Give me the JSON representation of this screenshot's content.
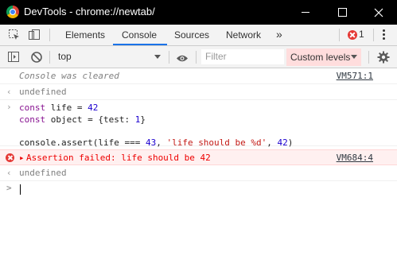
{
  "window": {
    "title": "DevTools - chrome://newtab/"
  },
  "tabs": {
    "items": [
      {
        "label": "Elements"
      },
      {
        "label": "Console"
      },
      {
        "label": "Sources"
      },
      {
        "label": "Network"
      }
    ],
    "more_label": "»",
    "error_count": "1"
  },
  "console_toolbar": {
    "context": "top",
    "filter_placeholder": "Filter",
    "levels_label": "Custom levels"
  },
  "messages": {
    "cleared": {
      "text": "Console was cleared",
      "source": "VM571:1"
    },
    "result1": {
      "text": "undefined"
    },
    "input1": {
      "line1_kw": "const",
      "line1_rest": " life = ",
      "line1_num": "42",
      "line2_kw": "const",
      "line2_rest": " object = {test: ",
      "line2_num": "1",
      "line2_end": "}",
      "line4_a": "console.assert(life === ",
      "line4_num1": "43",
      "line4_b": ", ",
      "line4_str": "'life should be %d'",
      "line4_c": ", ",
      "line4_num2": "42",
      "line4_d": ")"
    },
    "error": {
      "text": "Assertion failed: life should be 42",
      "source": "VM684:4"
    },
    "result2": {
      "text": "undefined"
    },
    "prompt": {
      "symbol": ">"
    }
  },
  "colors": {
    "accent": "#1a73e8",
    "error": "#e53935",
    "error_bg": "#fff0f0"
  }
}
